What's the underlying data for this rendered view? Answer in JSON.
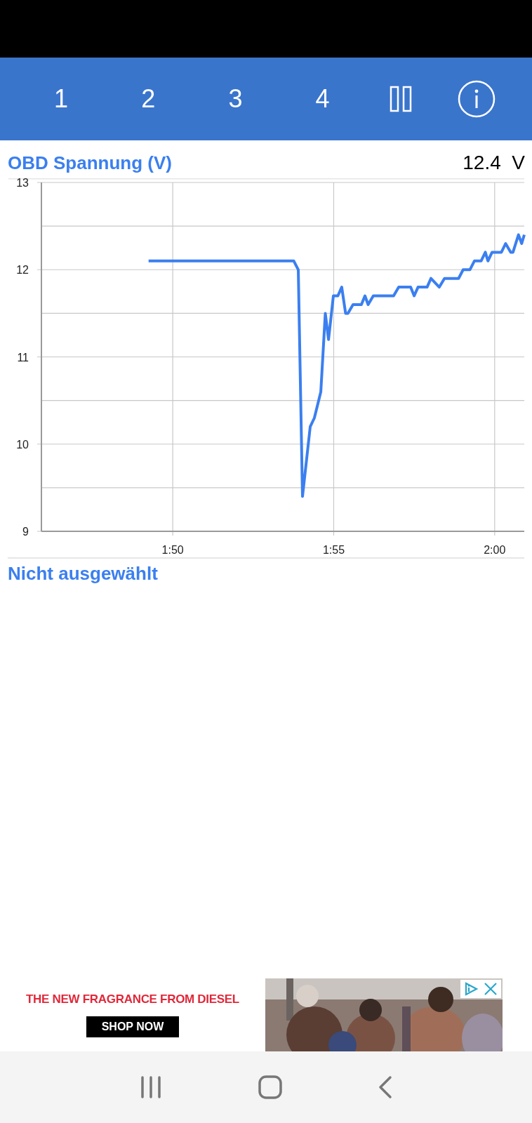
{
  "tabs": [
    {
      "label": "1"
    },
    {
      "label": "2"
    },
    {
      "label": "3"
    },
    {
      "label": "4"
    }
  ],
  "toolbar": {
    "reading": "12.4  V"
  },
  "chart": {
    "chart_data": {
      "type": "line",
      "title": "OBD Spannung (V)",
      "xlim": [
        105.92,
        120.92
      ],
      "ylim": [
        9,
        13
      ],
      "xticks": [
        {
          "value": 110,
          "label": "1:50"
        },
        {
          "value": 115,
          "label": "1:55"
        },
        {
          "value": 120,
          "label": "2:00"
        }
      ],
      "yticks": [
        9,
        10,
        11,
        12,
        13
      ],
      "x": [
        109.25,
        113.76,
        113.9,
        114.03,
        114.27,
        114.4,
        114.6,
        114.74,
        114.84,
        114.99,
        115.13,
        115.25,
        115.37,
        115.44,
        115.6,
        115.86,
        115.97,
        116.07,
        116.23,
        116.86,
        117.02,
        117.39,
        117.5,
        117.62,
        117.9,
        118.02,
        118.28,
        118.44,
        118.88,
        119.02,
        119.23,
        119.37,
        119.58,
        119.71,
        119.79,
        119.92,
        120.21,
        120.34,
        120.5,
        120.57,
        120.74,
        120.84,
        120.92
      ],
      "grid": true,
      "series": [
        {
          "color": "#3b7ff0",
          "values": [
            12.1,
            12.1,
            12.0,
            9.4,
            10.2,
            10.3,
            10.6,
            11.5,
            11.2,
            11.7,
            11.7,
            11.8,
            11.5,
            11.5,
            11.6,
            11.6,
            11.7,
            11.6,
            11.7,
            11.7,
            11.8,
            11.8,
            11.7,
            11.8,
            11.8,
            11.9,
            11.8,
            11.9,
            11.9,
            12.0,
            12.0,
            12.1,
            12.1,
            12.2,
            12.1,
            12.2,
            12.2,
            12.3,
            12.2,
            12.2,
            12.4,
            12.3,
            12.4
          ]
        }
      ]
    }
  },
  "second_chart": {
    "title": "Nicht ausgewählt"
  },
  "ad": {
    "headline": "THE NEW FRAGRANCE FROM DIESEL",
    "button": "SHOP NOW"
  }
}
